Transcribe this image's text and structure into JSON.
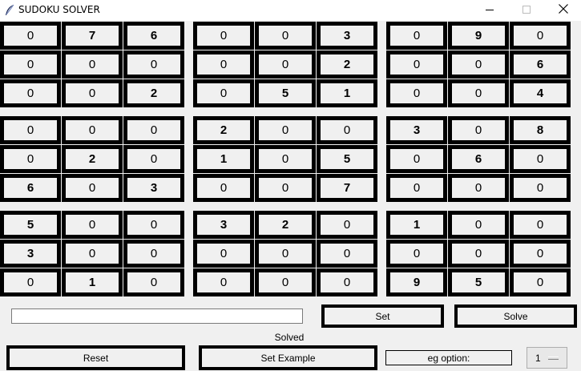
{
  "window": {
    "title": "SUDOKU SOLVER"
  },
  "grid": {
    "rows": [
      [
        "0",
        "7",
        "6",
        "0",
        "0",
        "3",
        "0",
        "9",
        "0"
      ],
      [
        "0",
        "0",
        "0",
        "0",
        "0",
        "2",
        "0",
        "0",
        "6"
      ],
      [
        "0",
        "0",
        "2",
        "0",
        "5",
        "1",
        "0",
        "0",
        "4"
      ],
      [
        "0",
        "0",
        "0",
        "2",
        "0",
        "0",
        "3",
        "0",
        "8"
      ],
      [
        "0",
        "2",
        "0",
        "1",
        "0",
        "5",
        "0",
        "6",
        "0"
      ],
      [
        "6",
        "0",
        "3",
        "0",
        "0",
        "7",
        "0",
        "0",
        "0"
      ],
      [
        "5",
        "0",
        "0",
        "3",
        "2",
        "0",
        "1",
        "0",
        "0"
      ],
      [
        "3",
        "0",
        "0",
        "0",
        "0",
        "0",
        "0",
        "0",
        "0"
      ],
      [
        "0",
        "1",
        "0",
        "0",
        "0",
        "0",
        "9",
        "5",
        "0"
      ]
    ]
  },
  "controls": {
    "input_value": "",
    "set_label": "Set",
    "solve_label": "Solve",
    "status": "Solved",
    "reset_label": "Reset",
    "example_label": "Set Example",
    "eg_option_label": "eg option:",
    "eg_option_value": "1"
  }
}
